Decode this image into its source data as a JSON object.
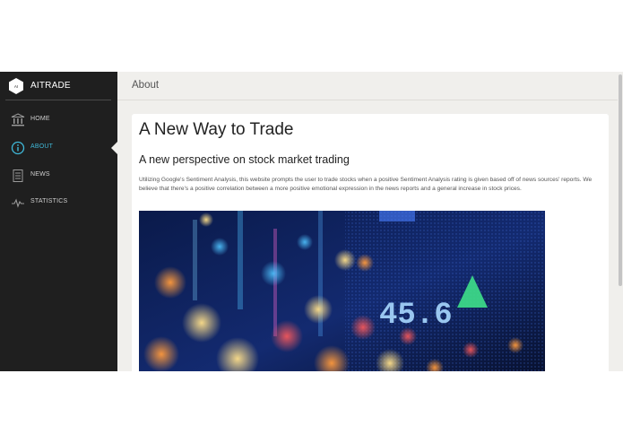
{
  "brand": {
    "name": "AITRADE",
    "logo_icon": "aitrade-logo-icon"
  },
  "sidebar": {
    "items": [
      {
        "label": "HOME",
        "icon": "bank-building-icon",
        "active": false
      },
      {
        "label": "ABOUT",
        "icon": "info-circle-icon",
        "active": true
      },
      {
        "label": "NEWS",
        "icon": "newspaper-icon",
        "active": false
      },
      {
        "label": "STATISTICS",
        "icon": "pulse-chart-icon",
        "active": false
      }
    ]
  },
  "header": {
    "title": "About"
  },
  "content": {
    "heading": "A New Way to Trade",
    "subheading": "A new perspective on stock market trading",
    "body": "Utilizing Google's Sentiment Analysis, this website prompts the user to trade stocks when a positive Sentiment Analysis rating is given based off of news sources' reports. We believe that there's a positive correlation between a more positive emotional expression in the news reports and a general increase in stock prices.",
    "hero_ticker_value": "45.6"
  },
  "colors": {
    "sidebar_bg": "#1f1f1f",
    "accent": "#3fb8d8",
    "page_bg": "#f0efec"
  }
}
